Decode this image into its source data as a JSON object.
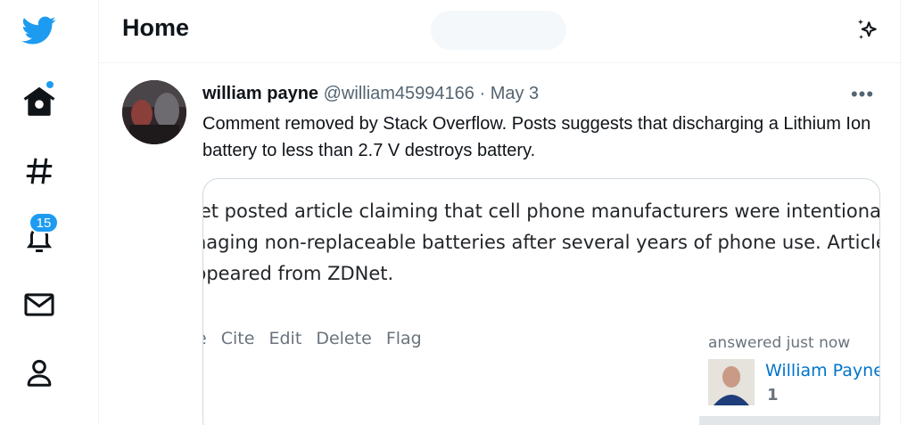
{
  "nav": {
    "items": [
      {
        "icon": "twitter-bird-icon"
      },
      {
        "icon": "home-icon"
      },
      {
        "icon": "explore-hashtag-icon"
      },
      {
        "icon": "notifications-bell-icon",
        "badge": "15"
      },
      {
        "icon": "messages-envelope-icon"
      },
      {
        "icon": "profile-person-icon"
      }
    ]
  },
  "header": {
    "title": "Home",
    "sparkle_icon": "sparkle-icon"
  },
  "tweet": {
    "author_name": "william payne",
    "handle": "@william45994166",
    "separator": "·",
    "date": "May 3",
    "more_label": "•••",
    "text": "Comment removed by Stack Overflow.  Posts suggests that discharging a Lithium Ion battery to less than 2.7 V destroys battery."
  },
  "media": {
    "lines": [
      "let posted article claiming that cell phone manufacturers were intentiona",
      "naging non-replaceable batteries after several years of phone use. Article",
      "ppeared from ZDNet."
    ],
    "actions": [
      "e",
      "Cite",
      "Edit",
      "Delete",
      "Flag"
    ],
    "answered": "answered just now",
    "user": "William Payne",
    "reputation": "1"
  },
  "colors": {
    "accent": "#1d9bf0",
    "text": "#0f1419",
    "secondary": "#536471",
    "so_link": "#0074cc"
  }
}
